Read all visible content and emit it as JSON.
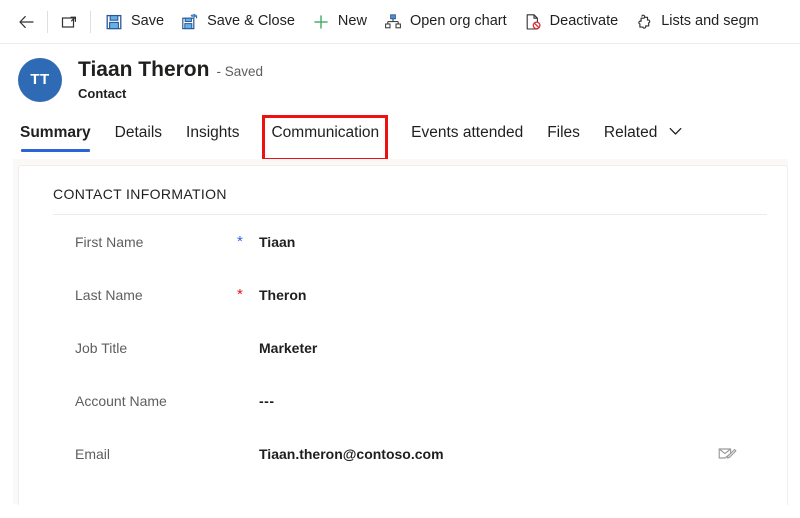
{
  "commandbar": {
    "items": [
      {
        "icon": "back-arrow-icon",
        "label": ""
      },
      {
        "icon": "open-in-new-window-icon",
        "label": ""
      },
      {
        "icon": "save-icon",
        "label": "Save"
      },
      {
        "icon": "save-and-close-icon",
        "label": "Save & Close"
      },
      {
        "icon": "plus-icon",
        "label": "New"
      },
      {
        "icon": "org-chart-icon",
        "label": "Open org chart"
      },
      {
        "icon": "deactivate-icon",
        "label": "Deactivate"
      },
      {
        "icon": "puzzle-piece-icon",
        "label": "Lists and segm"
      }
    ]
  },
  "record": {
    "avatar_initials": "TT",
    "title": "Tiaan Theron",
    "status": "- Saved",
    "subtitle": "Contact"
  },
  "tabs": [
    {
      "label": "Summary",
      "active": true,
      "highlighted": false,
      "chevron": false
    },
    {
      "label": "Details",
      "active": false,
      "highlighted": false,
      "chevron": false
    },
    {
      "label": "Insights",
      "active": false,
      "highlighted": false,
      "chevron": false
    },
    {
      "label": "Communication",
      "active": false,
      "highlighted": true,
      "chevron": false
    },
    {
      "label": "Events attended",
      "active": false,
      "highlighted": false,
      "chevron": false
    },
    {
      "label": "Files",
      "active": false,
      "highlighted": false,
      "chevron": false
    },
    {
      "label": "Related",
      "active": false,
      "highlighted": false,
      "chevron": true
    }
  ],
  "form": {
    "section_title": "CONTACT INFORMATION",
    "fields": [
      {
        "label": "First Name",
        "required": "recommended",
        "value": "Tiaan",
        "action_icon": ""
      },
      {
        "label": "Last Name",
        "required": "required",
        "value": "Theron",
        "action_icon": ""
      },
      {
        "label": "Job Title",
        "required": "none",
        "value": "Marketer",
        "action_icon": ""
      },
      {
        "label": "Account Name",
        "required": "none",
        "value": "---",
        "action_icon": ""
      },
      {
        "label": "Email",
        "required": "none",
        "value": "Tiaan.theron@contoso.com",
        "action_icon": "compose-email-icon"
      }
    ]
  },
  "colors": {
    "accent_blue": "#2b63d9",
    "avatar_blue": "#2f6ab4",
    "highlight_red": "#ee1111",
    "required_red": "#e81123",
    "recommended_blue": "#3a5fe0"
  }
}
